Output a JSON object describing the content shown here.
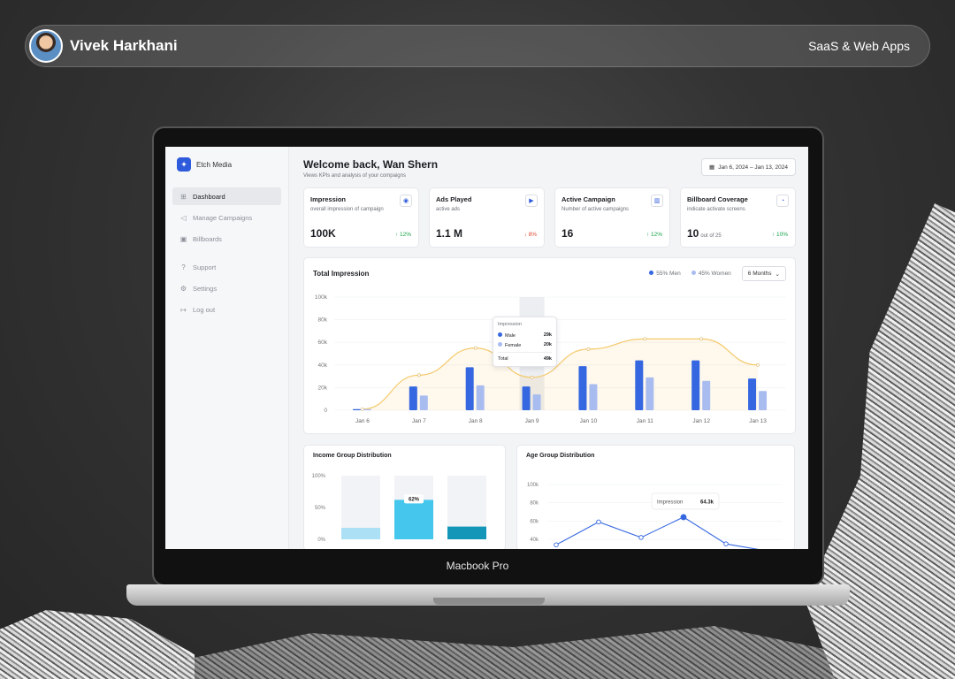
{
  "presenter": {
    "name": "Vivek Harkhani",
    "category": "SaaS & Web Apps"
  },
  "device": {
    "label": "Macbook Pro"
  },
  "app": {
    "brand": "Etch Media",
    "nav": [
      {
        "label": "Dashboard",
        "icon": "grid-icon",
        "glyph": "⊞",
        "active": true
      },
      {
        "label": "Manage Campaigns",
        "icon": "megaphone-icon",
        "glyph": "◁"
      },
      {
        "label": "Billboards",
        "icon": "image-icon",
        "glyph": "▣"
      }
    ],
    "nav_secondary": [
      {
        "label": "Support",
        "icon": "help-icon",
        "glyph": "?"
      },
      {
        "label": "Settings",
        "icon": "gear-icon",
        "glyph": "⚙"
      },
      {
        "label": "Log out",
        "icon": "logout-icon",
        "glyph": "↦"
      }
    ]
  },
  "header": {
    "title": "Welcome back, Wan Shern",
    "subtitle": "Views KPIs and analysis of your compaigns",
    "date_range": "Jan 6, 2024 – Jan 13, 2024"
  },
  "kpis": [
    {
      "title": "Impression",
      "desc": "overall impression of campaign",
      "value": "100K",
      "unit": "",
      "change": "12%",
      "dir": "up",
      "icon": "eye-icon",
      "glyph": "◉"
    },
    {
      "title": "Ads Played",
      "desc": "active ads",
      "value": "1.1 M",
      "unit": "",
      "change": "8%",
      "dir": "down",
      "icon": "play-icon",
      "glyph": "▶"
    },
    {
      "title": "Active Campaign",
      "desc": "Number of active campaigns",
      "value": "16",
      "unit": "",
      "change": "12%",
      "dir": "up",
      "icon": "bar-chart-icon",
      "glyph": "▥"
    },
    {
      "title": "Billboard Coverage",
      "desc": "indicate activate screens",
      "value": "10",
      "unit": "out of 25",
      "change": "10%",
      "dir": "up",
      "icon": "pie-chart-icon",
      "glyph": "◔"
    }
  ],
  "total_impression": {
    "title": "Total Impression",
    "legend": [
      "55% Men",
      "45% Women"
    ],
    "range": "6 Months",
    "tooltip": {
      "title": "Impression",
      "male_label": "Male",
      "male_value": "29k",
      "female_label": "Female",
      "female_value": "20k",
      "total_label": "Total",
      "total_value": "49k"
    }
  },
  "income": {
    "title": "Income Group Distribution",
    "label": "62%"
  },
  "age": {
    "title": "Age Group Distribution",
    "tooltip_label": "Impression",
    "tooltip_value": "64.3k"
  },
  "colors": {
    "men": "#3567e0",
    "women": "#a9bcf0",
    "line": "#f5c96a",
    "accent": "#2e5bdb"
  },
  "chart_data": [
    {
      "type": "bar",
      "title": "Total Impression",
      "categories": [
        "Jan 6",
        "Jan 7",
        "Jan 8",
        "Jan 9",
        "Jan 10",
        "Jan 11",
        "Jan 12",
        "Jan 13"
      ],
      "ylim": [
        0,
        100000
      ],
      "yticks": [
        "0",
        "20k",
        "40k",
        "60k",
        "80k",
        "100k"
      ],
      "series": [
        {
          "name": "55% Men",
          "values": [
            1000,
            21000,
            38000,
            21000,
            39000,
            44000,
            44000,
            28000
          ]
        },
        {
          "name": "45% Women",
          "values": [
            1000,
            13000,
            22000,
            14000,
            23000,
            29000,
            26000,
            17000
          ]
        }
      ],
      "line": [
        1000,
        31000,
        55000,
        29000,
        54000,
        63000,
        63000,
        40000
      ],
      "highlight_index": 3
    },
    {
      "type": "bar",
      "title": "Income Group Distribution",
      "yticks": [
        "0%",
        "50%",
        "100%"
      ],
      "values": [
        18,
        62,
        20
      ],
      "colors": [
        "#abe0f5",
        "#45c6ec",
        "#1496b8"
      ]
    },
    {
      "type": "line",
      "title": "Age Group Distribution",
      "yticks": [
        "40k",
        "60k",
        "80k",
        "100k"
      ],
      "values": [
        34000,
        59000,
        42000,
        64300,
        35000,
        27000
      ],
      "highlight_index": 3
    }
  ]
}
